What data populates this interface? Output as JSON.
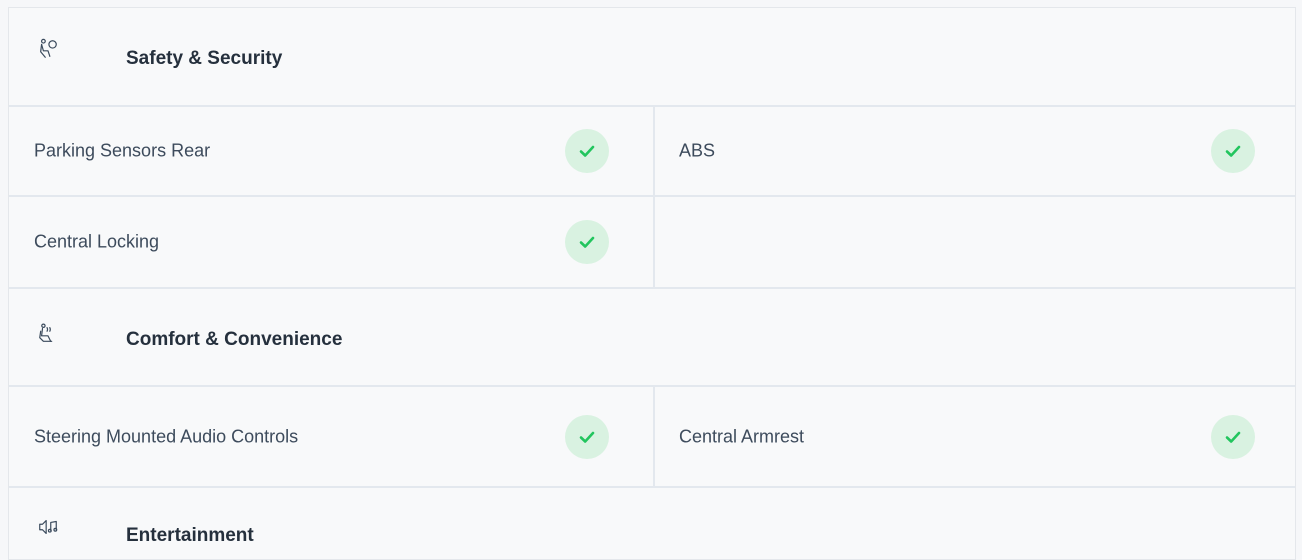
{
  "sections": [
    {
      "title": "Safety & Security",
      "icon": "airbag-seat-icon",
      "rows": [
        {
          "left": {
            "label": "Parking Sensors Rear",
            "available": true
          },
          "right": {
            "label": "ABS",
            "available": true
          }
        },
        {
          "left": {
            "label": "Central Locking",
            "available": true
          },
          "right": {
            "label": "",
            "available": false
          }
        }
      ]
    },
    {
      "title": "Comfort & Convenience",
      "icon": "seat-heating-icon",
      "rows": [
        {
          "left": {
            "label": "Steering Mounted Audio Controls",
            "available": true
          },
          "right": {
            "label": "Central Armrest",
            "available": true
          }
        }
      ]
    },
    {
      "title": "Entertainment",
      "icon": "speaker-music-icon",
      "rows": []
    }
  ],
  "colors": {
    "check": "#22c55e",
    "check_bg": "#d9f2e1",
    "border": "#e3e8ee"
  }
}
